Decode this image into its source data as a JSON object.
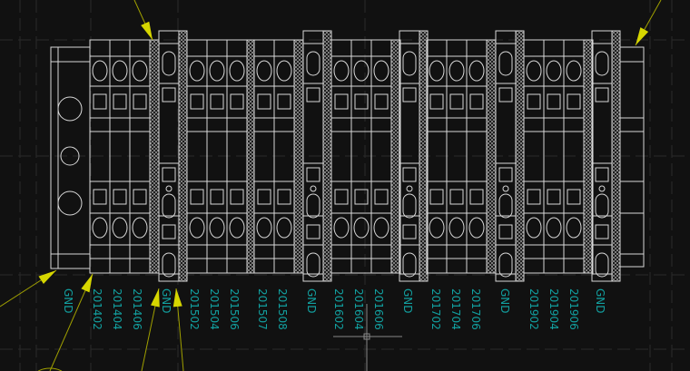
{
  "drawing": {
    "labels": [
      "GND",
      "201402",
      "201404",
      "201406",
      "GND",
      "201502",
      "201504",
      "201506",
      "201507",
      "201508",
      "GND",
      "201602",
      "201604",
      "201606",
      "GND",
      "201702",
      "201704",
      "201706",
      "GND",
      "201902",
      "201904",
      "201906",
      "GND"
    ],
    "colors": {
      "background": "#111111",
      "lines": "#d8d8d8",
      "labels": "#12a0a0",
      "arrows": "#d6d600",
      "grid": "#2a2a2a"
    }
  }
}
